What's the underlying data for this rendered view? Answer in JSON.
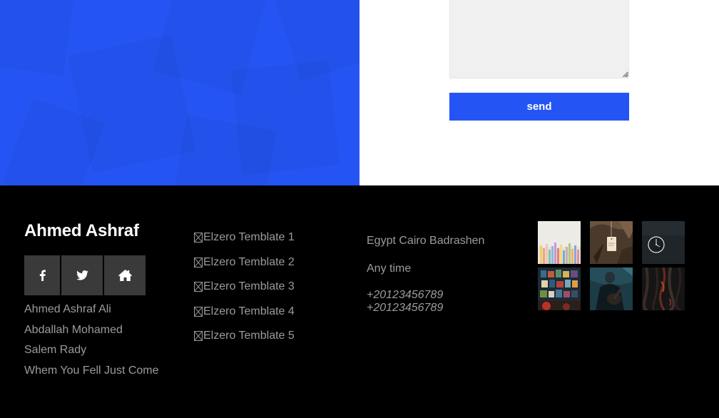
{
  "form": {
    "message_placeholder": "",
    "send_label": "send"
  },
  "footer": {
    "brand": "Ahmed Ashraf",
    "social_icons": [
      "facebook-icon",
      "twitter-icon",
      "home-icon"
    ],
    "names": [
      "Ahmed Ashraf Ali",
      "Abdallah Mohamed",
      "Salem Rady",
      "Whem You Fell Just Come"
    ],
    "links": [
      "Elzero Temblate 1",
      "Elzero Temblate 2",
      "Elzero Temblate 3",
      "Elzero Temblate 4",
      "Elzero Temblate 5"
    ],
    "contact": {
      "address": "Egypt Cairo Badrashen",
      "hours": "Any time",
      "phones": [
        "+20123456789",
        "+20123456789"
      ]
    },
    "gallery_images": [
      "colored-pencils-image",
      "hanging-tag-image",
      "wall-clock-image",
      "bookshelf-image",
      "person-with-guitar-image",
      "wood-bark-image"
    ]
  },
  "colors": {
    "accent": "#2554f5",
    "footer_bg": "#000000",
    "footer_text": "#9b9b9b",
    "social_bg": "#3a3a3a"
  }
}
